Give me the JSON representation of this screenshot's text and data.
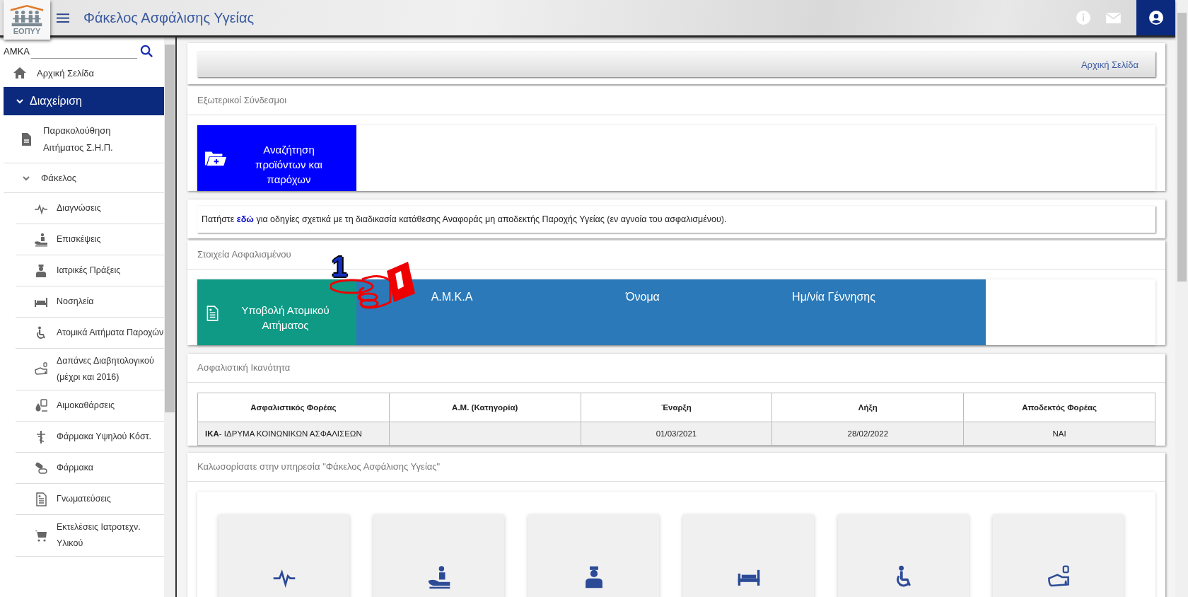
{
  "header": {
    "logo_text": "ΕΟΠΥΥ",
    "title": "Φάκελος Ασφάλισης Υγείας"
  },
  "sidebar": {
    "search": {
      "label": "ΑΜΚΑ"
    },
    "items": [
      {
        "kind": "link",
        "label": "Αρχική Σελίδα"
      },
      {
        "kind": "group",
        "label": "Διαχείριση",
        "expanded": true,
        "children": [
          {
            "kind": "link",
            "label": "Παρακολούθηση Αιτήματος Σ.Η.Π."
          },
          {
            "kind": "group",
            "label": "Φάκελος",
            "expanded": true,
            "children": [
              {
                "kind": "link",
                "label": "Διαγνώσεις"
              },
              {
                "kind": "link",
                "label": "Επισκέψεις"
              },
              {
                "kind": "link",
                "label": "Ιατρικές Πράξεις"
              },
              {
                "kind": "link",
                "label": "Νοσηλεία"
              },
              {
                "kind": "link",
                "label": "Ατομικά Αιτήματα Παροχών"
              },
              {
                "kind": "link",
                "label": "Δαπάνες Διαβητολογικού (μέχρι και 2016)"
              },
              {
                "kind": "link",
                "label": "Αιμοκαθάρσεις"
              },
              {
                "kind": "link",
                "label": "Φάρμακα Υψηλού Κόστ."
              },
              {
                "kind": "link",
                "label": "Φάρμακα"
              },
              {
                "kind": "link",
                "label": "Γνωματεύσεις"
              },
              {
                "kind": "link",
                "label": "Εκτελέσεις Ιατροτεχν. Υλικού"
              }
            ]
          }
        ]
      }
    ]
  },
  "breadcrumb": "Αρχική Σελίδα",
  "external_links": {
    "title": "Εξωτερικοί Σύνδεσμοι",
    "tile": "Αναζήτηση προϊόντων και παρόχων"
  },
  "notice": "Πατήστε **εδώ** για οδηγίες σχετικά με τη διαδικασία κατάθεσης Αναφοράς μη αποδεκτής Παροχής Υγείας (εν αγνοία του ασφαλισμένου).",
  "insured": {
    "title": "Στοιχεία Ασφαλισμένου",
    "action": "Υποβολή Ατομικού Αιτήματος",
    "fields": [
      "Α.Μ.Κ.Α",
      "Όνομα",
      "Ημ/νία Γέννησης"
    ],
    "annotation": "1"
  },
  "eligibility": {
    "title": "Ασφαλιστική Ικανότητα",
    "table": {
      "columns": [
        "Ασφαλιστικός Φορέας",
        "Α.Μ. (Κατηγορία)",
        "Έναρξη",
        "Λήξη",
        "Αποδεκτός Φορέας"
      ],
      "rows": [
        [
          "**ΙΚΑ**- ΙΔΡΥΜΑ ΚΟΙΝΩΝΙΚΩΝ ΑΣΦΑΛΙΣΕΩΝ",
          "",
          "01/03/2021",
          "28/02/2022",
          "ΝΑΙ"
        ]
      ]
    }
  },
  "welcome": {
    "title": "Καλωσορίσατε στην υπηρεσία \"Φάκελος Ασφάλισης Υγείας\"",
    "tiles": [
      {
        "kind": "service"
      },
      {
        "kind": "service"
      },
      {
        "kind": "service"
      },
      {
        "kind": "service"
      },
      {
        "kind": "service"
      },
      {
        "kind": "service"
      }
    ]
  }
}
